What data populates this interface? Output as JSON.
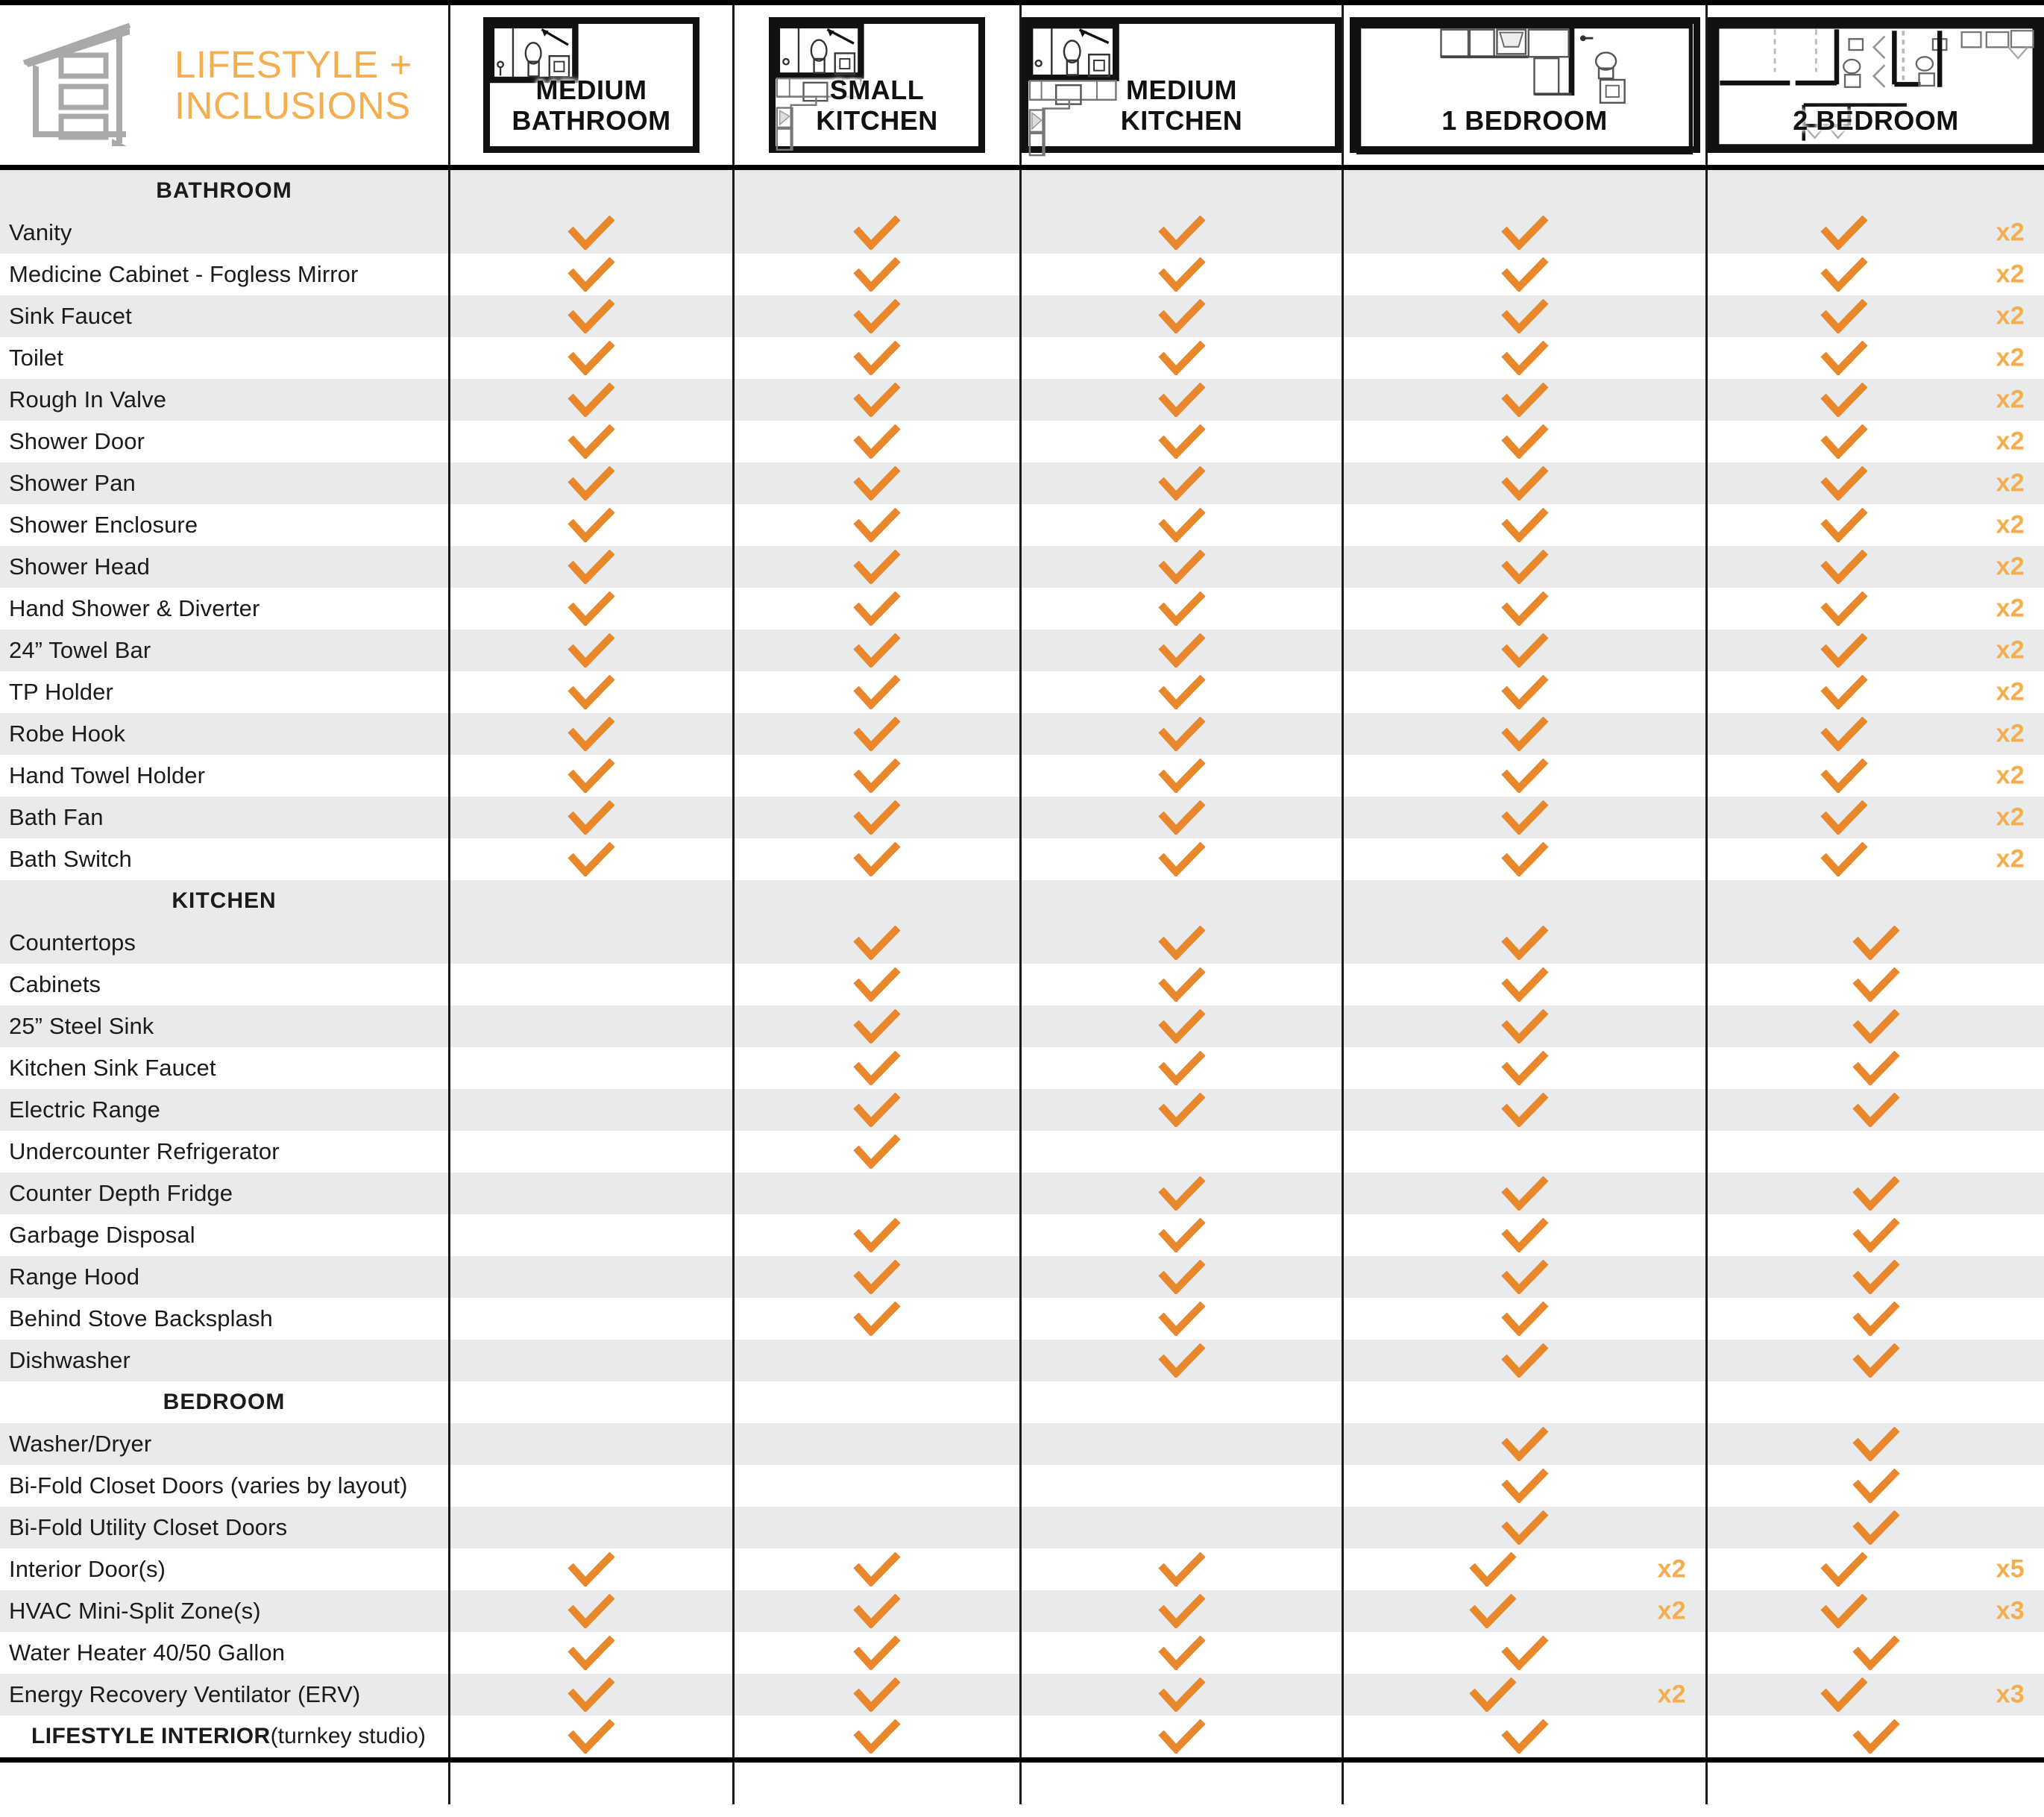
{
  "brand": {
    "title": "LIFESTYLE +\nINCLUSIONS",
    "logo_icon": "house-outline-logo",
    "accent_color": "#F5AD4E",
    "check_color": "#E8872B"
  },
  "columns": [
    {
      "key": "medium_bathroom",
      "label": "MEDIUM\nBATHROOM",
      "plan_icon": "floorplan-medium-bathroom"
    },
    {
      "key": "small_kitchen",
      "label": "SMALL\nKITCHEN",
      "plan_icon": "floorplan-small-kitchen"
    },
    {
      "key": "medium_kitchen",
      "label": "MEDIUM\nKITCHEN",
      "plan_icon": "floorplan-medium-kitchen"
    },
    {
      "key": "one_bedroom",
      "label": "1 BEDROOM",
      "plan_icon": "floorplan-1-bedroom"
    },
    {
      "key": "two_bedroom",
      "label": "2 BEDROOM",
      "plan_icon": "floorplan-2-bedroom"
    }
  ],
  "sections": [
    {
      "title": "BATHROOM",
      "rows": [
        {
          "label": "Vanity",
          "cells": [
            "✓",
            "✓",
            "✓",
            "✓",
            "✓"
          ],
          "mult": [
            "",
            "",
            "",
            "",
            "x2"
          ]
        },
        {
          "label": "Medicine Cabinet - Fogless Mirror",
          "cells": [
            "✓",
            "✓",
            "✓",
            "✓",
            "✓"
          ],
          "mult": [
            "",
            "",
            "",
            "",
            "x2"
          ]
        },
        {
          "label": "Sink Faucet",
          "cells": [
            "✓",
            "✓",
            "✓",
            "✓",
            "✓"
          ],
          "mult": [
            "",
            "",
            "",
            "",
            "x2"
          ]
        },
        {
          "label": "Toilet",
          "cells": [
            "✓",
            "✓",
            "✓",
            "✓",
            "✓"
          ],
          "mult": [
            "",
            "",
            "",
            "",
            "x2"
          ]
        },
        {
          "label": "Rough In Valve",
          "cells": [
            "✓",
            "✓",
            "✓",
            "✓",
            "✓"
          ],
          "mult": [
            "",
            "",
            "",
            "",
            "x2"
          ]
        },
        {
          "label": "Shower Door",
          "cells": [
            "✓",
            "✓",
            "✓",
            "✓",
            "✓"
          ],
          "mult": [
            "",
            "",
            "",
            "",
            "x2"
          ]
        },
        {
          "label": "Shower Pan",
          "cells": [
            "✓",
            "✓",
            "✓",
            "✓",
            "✓"
          ],
          "mult": [
            "",
            "",
            "",
            "",
            "x2"
          ]
        },
        {
          "label": "Shower Enclosure",
          "cells": [
            "✓",
            "✓",
            "✓",
            "✓",
            "✓"
          ],
          "mult": [
            "",
            "",
            "",
            "",
            "x2"
          ]
        },
        {
          "label": "Shower Head",
          "cells": [
            "✓",
            "✓",
            "✓",
            "✓",
            "✓"
          ],
          "mult": [
            "",
            "",
            "",
            "",
            "x2"
          ]
        },
        {
          "label": "Hand Shower & Diverter",
          "cells": [
            "✓",
            "✓",
            "✓",
            "✓",
            "✓"
          ],
          "mult": [
            "",
            "",
            "",
            "",
            "x2"
          ]
        },
        {
          "label": "24” Towel Bar",
          "cells": [
            "✓",
            "✓",
            "✓",
            "✓",
            "✓"
          ],
          "mult": [
            "",
            "",
            "",
            "",
            "x2"
          ]
        },
        {
          "label": "TP Holder",
          "cells": [
            "✓",
            "✓",
            "✓",
            "✓",
            "✓"
          ],
          "mult": [
            "",
            "",
            "",
            "",
            "x2"
          ]
        },
        {
          "label": "Robe Hook",
          "cells": [
            "✓",
            "✓",
            "✓",
            "✓",
            "✓"
          ],
          "mult": [
            "",
            "",
            "",
            "",
            "x2"
          ]
        },
        {
          "label": "Hand Towel Holder",
          "cells": [
            "✓",
            "✓",
            "✓",
            "✓",
            "✓"
          ],
          "mult": [
            "",
            "",
            "",
            "",
            "x2"
          ]
        },
        {
          "label": "Bath Fan",
          "cells": [
            "✓",
            "✓",
            "✓",
            "✓",
            "✓"
          ],
          "mult": [
            "",
            "",
            "",
            "",
            "x2"
          ]
        },
        {
          "label": "Bath Switch",
          "cells": [
            "✓",
            "✓",
            "✓",
            "✓",
            "✓"
          ],
          "mult": [
            "",
            "",
            "",
            "",
            "x2"
          ]
        }
      ]
    },
    {
      "title": "KITCHEN",
      "rows": [
        {
          "label": "Countertops",
          "cells": [
            "",
            "✓",
            "✓",
            "✓",
            "✓"
          ],
          "mult": [
            "",
            "",
            "",
            "",
            ""
          ]
        },
        {
          "label": "Cabinets",
          "cells": [
            "",
            "✓",
            "✓",
            "✓",
            "✓"
          ],
          "mult": [
            "",
            "",
            "",
            "",
            ""
          ]
        },
        {
          "label": "25” Steel Sink",
          "cells": [
            "",
            "✓",
            "✓",
            "✓",
            "✓"
          ],
          "mult": [
            "",
            "",
            "",
            "",
            ""
          ]
        },
        {
          "label": "Kitchen Sink Faucet",
          "cells": [
            "",
            "✓",
            "✓",
            "✓",
            "✓"
          ],
          "mult": [
            "",
            "",
            "",
            "",
            ""
          ]
        },
        {
          "label": "Electric Range",
          "cells": [
            "",
            "✓",
            "✓",
            "✓",
            "✓"
          ],
          "mult": [
            "",
            "",
            "",
            "",
            ""
          ]
        },
        {
          "label": "Undercounter Refrigerator",
          "cells": [
            "",
            "✓",
            "",
            "",
            ""
          ],
          "mult": [
            "",
            "",
            "",
            "",
            ""
          ]
        },
        {
          "label": "Counter Depth Fridge",
          "cells": [
            "",
            "",
            "✓",
            "✓",
            "✓"
          ],
          "mult": [
            "",
            "",
            "",
            "",
            ""
          ]
        },
        {
          "label": "Garbage Disposal",
          "cells": [
            "",
            "✓",
            "✓",
            "✓",
            "✓"
          ],
          "mult": [
            "",
            "",
            "",
            "",
            ""
          ]
        },
        {
          "label": "Range Hood",
          "cells": [
            "",
            "✓",
            "✓",
            "✓",
            "✓"
          ],
          "mult": [
            "",
            "",
            "",
            "",
            ""
          ]
        },
        {
          "label": "Behind Stove Backsplash",
          "cells": [
            "",
            "✓",
            "✓",
            "✓",
            "✓"
          ],
          "mult": [
            "",
            "",
            "",
            "",
            ""
          ]
        },
        {
          "label": "Dishwasher",
          "cells": [
            "",
            "",
            "✓",
            "✓",
            "✓"
          ],
          "mult": [
            "",
            "",
            "",
            "",
            ""
          ]
        }
      ]
    },
    {
      "title": "BEDROOM",
      "rows": [
        {
          "label": "Washer/Dryer",
          "cells": [
            "",
            "",
            "",
            "✓",
            "✓"
          ],
          "mult": [
            "",
            "",
            "",
            "",
            ""
          ]
        },
        {
          "label": "Bi-Fold Closet Doors (varies by layout)",
          "cells": [
            "",
            "",
            "",
            "✓",
            "✓"
          ],
          "mult": [
            "",
            "",
            "",
            "",
            ""
          ]
        },
        {
          "label": "Bi-Fold Utility Closet Doors",
          "cells": [
            "",
            "",
            "",
            "✓",
            "✓"
          ],
          "mult": [
            "",
            "",
            "",
            "",
            ""
          ]
        },
        {
          "label": "Interior Door(s)",
          "cells": [
            "✓",
            "✓",
            "✓",
            "✓",
            "✓"
          ],
          "mult": [
            "",
            "",
            "",
            "x2",
            "x5"
          ]
        },
        {
          "label": "HVAC Mini-Split Zone(s)",
          "cells": [
            "✓",
            "✓",
            "✓",
            "✓",
            "✓"
          ],
          "mult": [
            "",
            "",
            "",
            "x2",
            "x3"
          ]
        },
        {
          "label": "Water Heater 40/50 Gallon",
          "cells": [
            "✓",
            "✓",
            "✓",
            "✓",
            "✓"
          ],
          "mult": [
            "",
            "",
            "",
            "",
            ""
          ]
        },
        {
          "label": "Energy Recovery Ventilator (ERV)",
          "cells": [
            "✓",
            "✓",
            "✓",
            "✓",
            "✓"
          ],
          "mult": [
            "",
            "",
            "",
            "x2",
            "x3"
          ]
        }
      ]
    }
  ],
  "final_row": {
    "label_bold": "LIFESTYLE INTERIOR",
    "label_rest": " (turnkey studio)",
    "cells": [
      "✓",
      "✓",
      "✓",
      "✓",
      "✓"
    ],
    "mult": [
      "",
      "",
      "",
      "",
      ""
    ]
  }
}
